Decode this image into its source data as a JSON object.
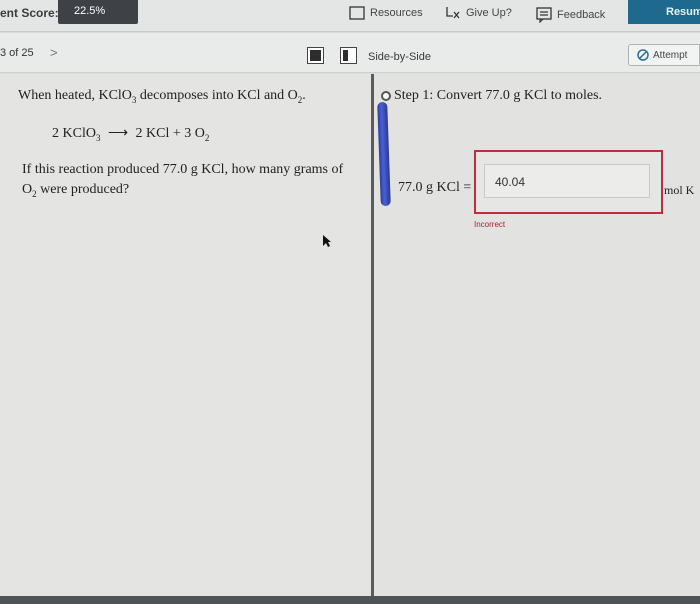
{
  "header": {
    "score_label": "ent Score:",
    "score_value": "22.5%",
    "resources_label": "Resources",
    "giveup_label": "Give Up?",
    "feedback_label": "Feedback",
    "resume_label": "Resum"
  },
  "subbar": {
    "question_counter": "3 of 25",
    "next_glyph": ">",
    "view_mode_label": "Side-by-Side",
    "attempt_label": "Attempt"
  },
  "question": {
    "intro": "When heated, KClO",
    "intro_sub": "3",
    "intro_mid": " decomposes into KCl and O",
    "intro_sub2": "2",
    "intro_end": ".",
    "eq_left": "2 KClO",
    "eq_left_sub": "3",
    "eq_arrow": "⟶",
    "eq_right": "2 KCl + 3 O",
    "eq_right_sub": "2",
    "body_start": "If this reaction produced 77.0 g KCl, how many grams of O",
    "body_sub": "2",
    "body_end": " were produced?"
  },
  "step": {
    "text": "Step 1: Convert 77.0 g KCl to moles.",
    "equation_label": "77.0 g KCl =",
    "answer_value": "40.04",
    "feedback": "Incorrect",
    "unit": "mol K"
  },
  "colors": {
    "resume_bg": "#1d6a8e",
    "score_bg": "#3e4246",
    "incorrect": "#b01e2d",
    "answer_border": "#c42b3a"
  }
}
